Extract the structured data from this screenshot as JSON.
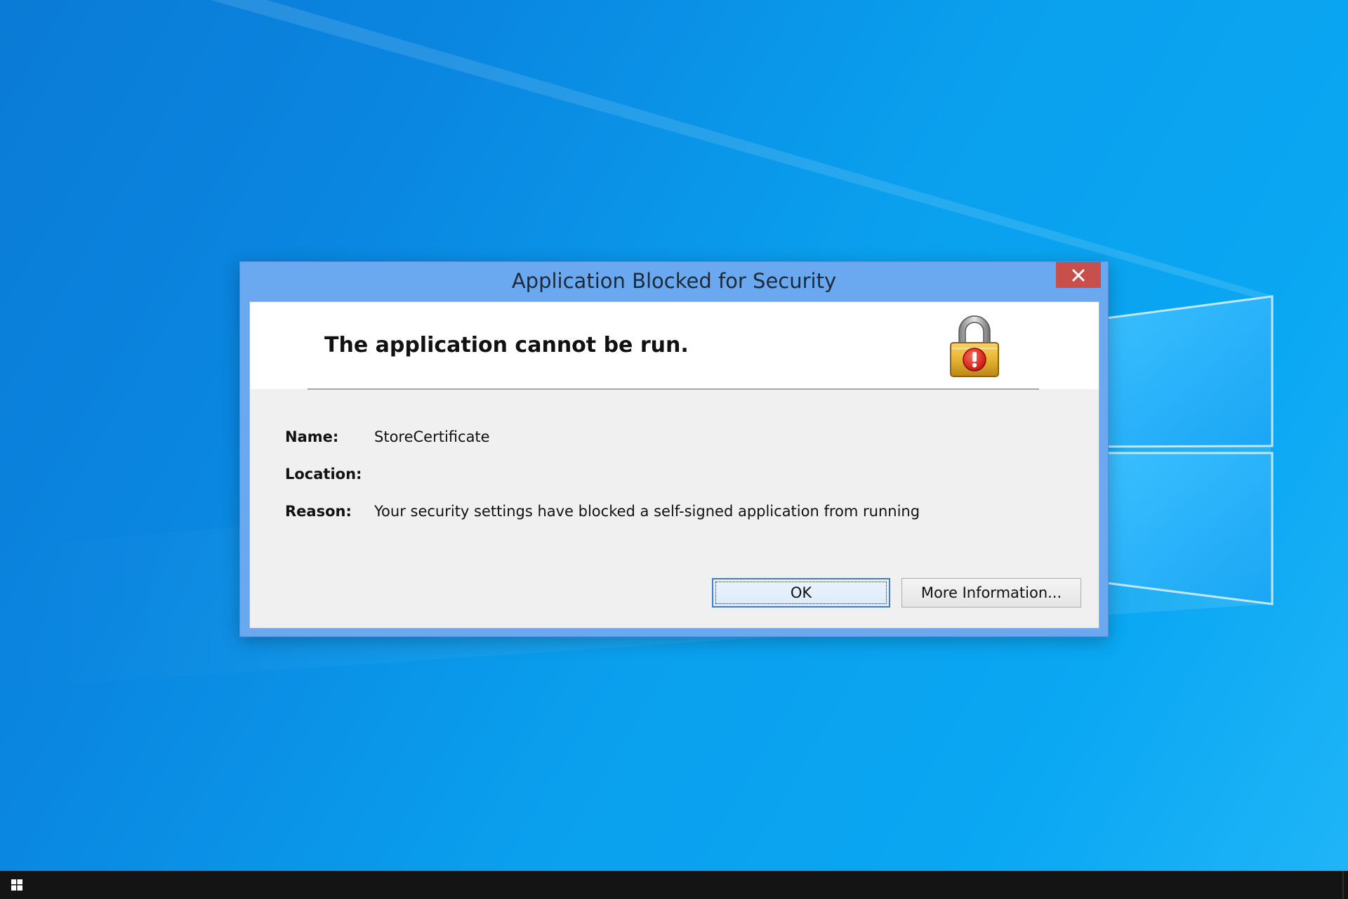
{
  "dialog": {
    "title": "Application Blocked for Security",
    "close_icon": "close-icon",
    "header": "The application cannot be run.",
    "header_icon": "padlock-warning-icon",
    "fields": {
      "name_label": "Name:",
      "name_value": "StoreCertificate",
      "location_label": "Location:",
      "location_value": "",
      "reason_label": "Reason:",
      "reason_value": "Your security settings have blocked a self-signed application from running"
    },
    "buttons": {
      "ok": "OK",
      "more_info": "More Information..."
    }
  },
  "taskbar": {
    "start_icon": "windows-logo-icon"
  },
  "colors": {
    "titlebar": "#6aa8f0",
    "close_button": "#c7504d",
    "desktop_blue": "#0a98ea",
    "taskbar": "#141414"
  }
}
